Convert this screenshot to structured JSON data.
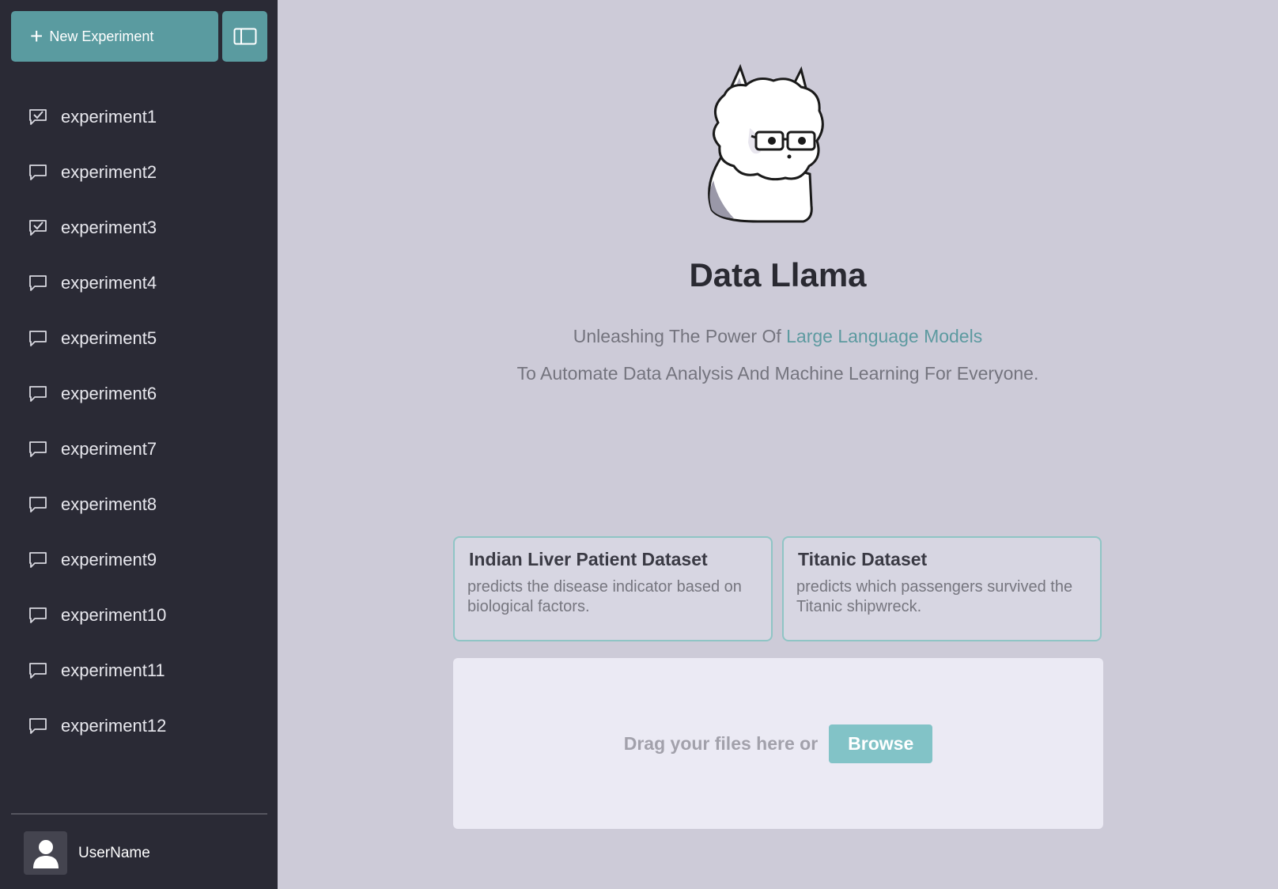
{
  "sidebar": {
    "new_experiment_label": "New Experiment",
    "experiments": [
      {
        "label": "experiment1",
        "icon": "chat-check-icon"
      },
      {
        "label": "experiment2",
        "icon": "chat-icon"
      },
      {
        "label": "experiment3",
        "icon": "chat-check-icon"
      },
      {
        "label": "experiment4",
        "icon": "chat-icon"
      },
      {
        "label": "experiment5",
        "icon": "chat-icon"
      },
      {
        "label": "experiment6",
        "icon": "chat-icon"
      },
      {
        "label": "experiment7",
        "icon": "chat-icon"
      },
      {
        "label": "experiment8",
        "icon": "chat-icon"
      },
      {
        "label": "experiment9",
        "icon": "chat-icon"
      },
      {
        "label": "experiment10",
        "icon": "chat-icon"
      },
      {
        "label": "experiment11",
        "icon": "chat-icon"
      },
      {
        "label": "experiment12",
        "icon": "chat-icon"
      }
    ],
    "username": "UserName"
  },
  "main": {
    "title": "Data Llama",
    "tagline_prefix": "Unleashing The Power Of ",
    "tagline_highlight": "Large Language Models",
    "tagline_rest": "To Automate Data Analysis And Machine Learning For Everyone.",
    "cards": [
      {
        "title": "Indian Liver Patient Dataset",
        "description": "predicts the disease indicator based on biological factors."
      },
      {
        "title": "Titanic Dataset",
        "description": "predicts which passengers survived the Titanic shipwreck."
      }
    ],
    "drop_text": "Drag your files here or",
    "browse_label": "Browse"
  },
  "colors": {
    "sidebar_bg": "#2a2a35",
    "accent": "#5a9ba0",
    "main_bg": "#cdcbd8",
    "browse_bg": "#82c3c7"
  }
}
